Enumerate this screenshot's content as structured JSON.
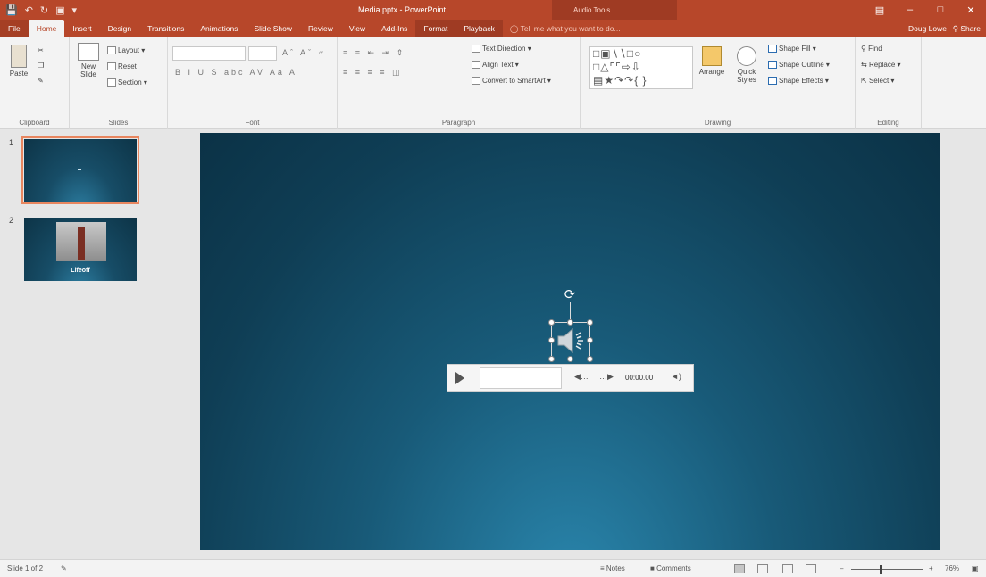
{
  "window": {
    "title": "Media.pptx - PowerPoint",
    "context_group": "Audio Tools",
    "user": "Doug Lowe",
    "share": "Share"
  },
  "tabs": [
    "File",
    "Home",
    "Insert",
    "Design",
    "Transitions",
    "Animations",
    "Slide Show",
    "Review",
    "View",
    "Add-Ins",
    "Format",
    "Playback"
  ],
  "active_tab": "Home",
  "tell_me": "Tell me what you want to do...",
  "ribbon": {
    "clipboard": {
      "paste": "Paste",
      "label": "Clipboard"
    },
    "slides": {
      "new_slide": "New Slide",
      "layout": "Layout",
      "reset": "Reset",
      "section": "Section",
      "label": "Slides"
    },
    "font": {
      "label": "Font"
    },
    "paragraph": {
      "text_direction": "Text Direction",
      "align_text": "Align Text",
      "smartart": "Convert to SmartArt",
      "label": "Paragraph"
    },
    "drawing": {
      "arrange": "Arrange",
      "quick_styles": "Quick Styles",
      "shape_fill": "Shape Fill",
      "shape_outline": "Shape Outline",
      "shape_effects": "Shape Effects",
      "label": "Drawing"
    },
    "editing": {
      "find": "Find",
      "replace": "Replace",
      "select": "Select",
      "label": "Editing"
    }
  },
  "thumbnails": [
    {
      "number": "1",
      "title": ""
    },
    {
      "number": "2",
      "title": "Lifeoff"
    }
  ],
  "player": {
    "time": "00:00.00"
  },
  "status": {
    "slide_info": "Slide 1 of 2",
    "notes": "Notes",
    "comments": "Comments",
    "zoom": "76%"
  },
  "colors": {
    "accent": "#b7472a",
    "slide_dark": "#0d3447",
    "slide_light": "#2a86ad"
  }
}
